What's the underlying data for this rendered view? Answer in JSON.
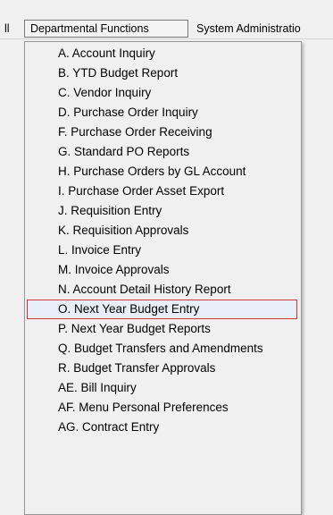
{
  "menubar": {
    "prev_label": "ll",
    "active_label": "Departmental Functions",
    "next_label": "System Administratio"
  },
  "dropdown": {
    "items": [
      {
        "label": "A. Account Inquiry"
      },
      {
        "label": "B. YTD Budget Report"
      },
      {
        "label": "C. Vendor Inquiry"
      },
      {
        "label": "D. Purchase Order Inquiry"
      },
      {
        "label": "F. Purchase Order Receiving"
      },
      {
        "label": "G. Standard PO Reports"
      },
      {
        "label": "H. Purchase Orders by GL Account"
      },
      {
        "label": "I. Purchase Order Asset Export"
      },
      {
        "label": "J. Requisition Entry"
      },
      {
        "label": "K. Requisition Approvals"
      },
      {
        "label": "L. Invoice Entry"
      },
      {
        "label": "M. Invoice Approvals"
      },
      {
        "label": "N. Account Detail History Report"
      },
      {
        "label": "O. Next Year Budget Entry"
      },
      {
        "label": "P. Next Year Budget Reports"
      },
      {
        "label": "Q. Budget Transfers and Amendments"
      },
      {
        "label": "R. Budget Transfer Approvals"
      },
      {
        "label": "AE. Bill Inquiry"
      },
      {
        "label": "AF. Menu Personal Preferences"
      },
      {
        "label": "AG. Contract Entry"
      }
    ],
    "selected_item": "O. Next Year Budget Entry",
    "highlight_color": "#d1343d"
  }
}
